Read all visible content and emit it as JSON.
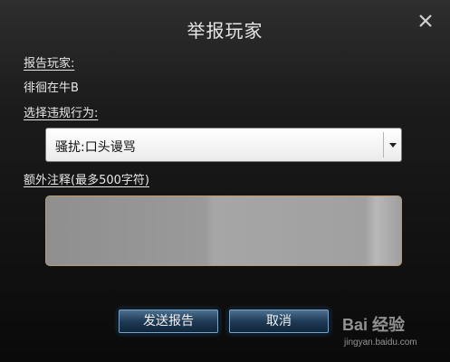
{
  "dialog": {
    "title": "举报玩家",
    "close_icon": "close-icon"
  },
  "form": {
    "player_label": "报告玩家:",
    "player_name": "徘徊在牛B",
    "violation_label": "选择违规行为:",
    "violation_selected": "骚扰:口头谩骂",
    "notes_label": "额外注释(最多500字符)",
    "notes_value": ""
  },
  "buttons": {
    "send": "发送报告",
    "cancel": "取消"
  },
  "watermark": {
    "logo": "Bai 经验",
    "url": "jingyan.baidu.com"
  }
}
